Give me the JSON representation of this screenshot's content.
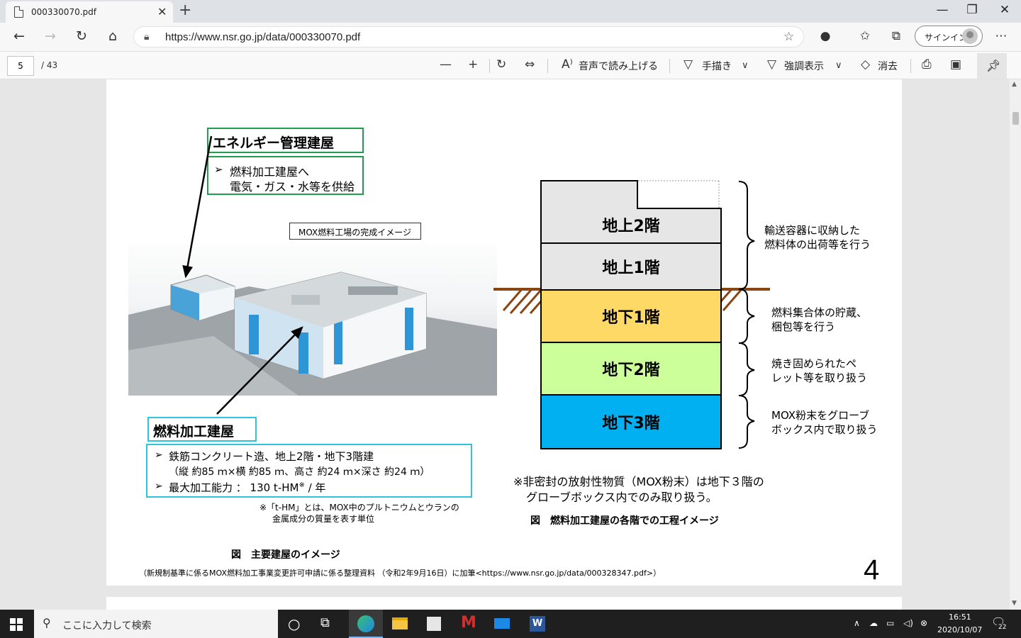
{
  "browser": {
    "tab_title": "000330070.pdf",
    "tab_close": "✕",
    "new_tab": "+",
    "url": "https://www.nsr.go.jp/data/000330070.pdf",
    "signin_label": "サインイン",
    "window_buttons": [
      "—",
      "❐",
      "✕"
    ]
  },
  "pdf_toolbar": {
    "current_page": "5",
    "total_pages": "/ 43",
    "read_aloud": "音声で読み上げる",
    "draw": "手描き",
    "highlight": "強調表示",
    "erase": "消去"
  },
  "slide": {
    "energy_building": {
      "title": "エネルギー管理建屋",
      "bullet_line1": "燃料加工建屋へ",
      "bullet_line2": "電気・ガス・水等を供給"
    },
    "render_caption": "MOX燃料工場の完成イメージ",
    "fuel_building": {
      "title": "燃料加工建屋",
      "bullet1": "鉄筋コンクリート造、地上2階・地下3階建",
      "bullet1_sub": "（縦 約85 ｍ×横 約85 ｍ、高さ 約24 ｍ×深さ 約24 ｍ）",
      "bullet2_pre": "最大加工能力 ： 130 t-HM",
      "bullet2_sup": "※",
      "bullet2_post": " / 年"
    },
    "footnote_line1": "※「t-HM」とは、MOX中のプルトニウムとウランの",
    "footnote_line2": "金属成分の質量を表す単位",
    "figure_left_caption": "図　主要建屋のイメージ",
    "source_note": "（新規制基準に係るMOX燃料加工事業変更許可申請に係る整理資料 （令和2年9月16日）に加筆<https://www.nsr.go.jp/data/000328347.pdf>）",
    "page_number": "4",
    "floors": [
      {
        "label": "地上2階",
        "color": "#e6e6e6"
      },
      {
        "label": "地上1階",
        "color": "#e6e6e6"
      },
      {
        "label": "地下1階",
        "color": "#ffd966"
      },
      {
        "label": "地下2階",
        "color": "#ccff99"
      },
      {
        "label": "地下3階",
        "color": "#00b0f0"
      }
    ],
    "floor_notes": [
      {
        "line1": "輸送容器に収納した",
        "line2": "燃料体の出荷等を行う"
      },
      {
        "line1": "燃料集合体の貯蔵、",
        "line2": "梱包等を行う"
      },
      {
        "line1": "焼き固められたペ",
        "line2": "レット等を取り扱う"
      },
      {
        "line1": "MOX粉末をグローブ",
        "line2": "ボックス内で取り扱う"
      }
    ],
    "notice_line1": "※非密封の放射性物質（MOX粉末）は地下３階の",
    "notice_line2": "グローブボックス内でのみ取り扱う。",
    "figure_right_caption": "図　燃料加工建屋の各階での工程イメージ"
  },
  "taskbar": {
    "search_placeholder": "ここに入力して検索",
    "time": "16:51",
    "date": "2020/10/07",
    "notification_count": "22"
  },
  "colors": {
    "green_box": "#1e9e4e",
    "cyan_box": "#2ec4dc",
    "ground": "#8b4513"
  }
}
